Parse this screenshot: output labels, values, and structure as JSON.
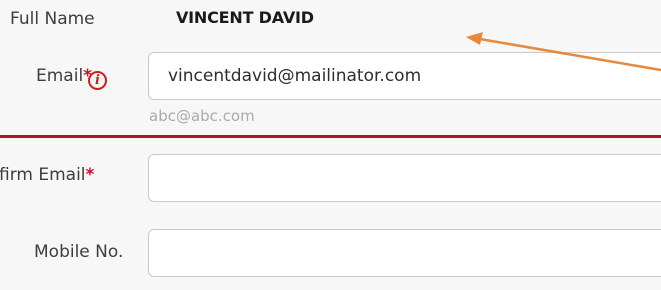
{
  "full_name": {
    "label": "Full Name",
    "value": "VINCENT DAVID"
  },
  "email": {
    "label": "Email",
    "required_mark": "*",
    "info_icon": "info-icon",
    "info_glyph": "i",
    "value": "vincentdavid@mailinator.com",
    "hint": "abc@abc.com"
  },
  "confirm_email": {
    "label": "firm Email",
    "required_mark": "*",
    "value": ""
  },
  "mobile": {
    "label": "Mobile No.",
    "value": ""
  },
  "colors": {
    "required": "#c8102e",
    "divider": "#b0141f",
    "annotation_arrow": "#e8883a"
  }
}
